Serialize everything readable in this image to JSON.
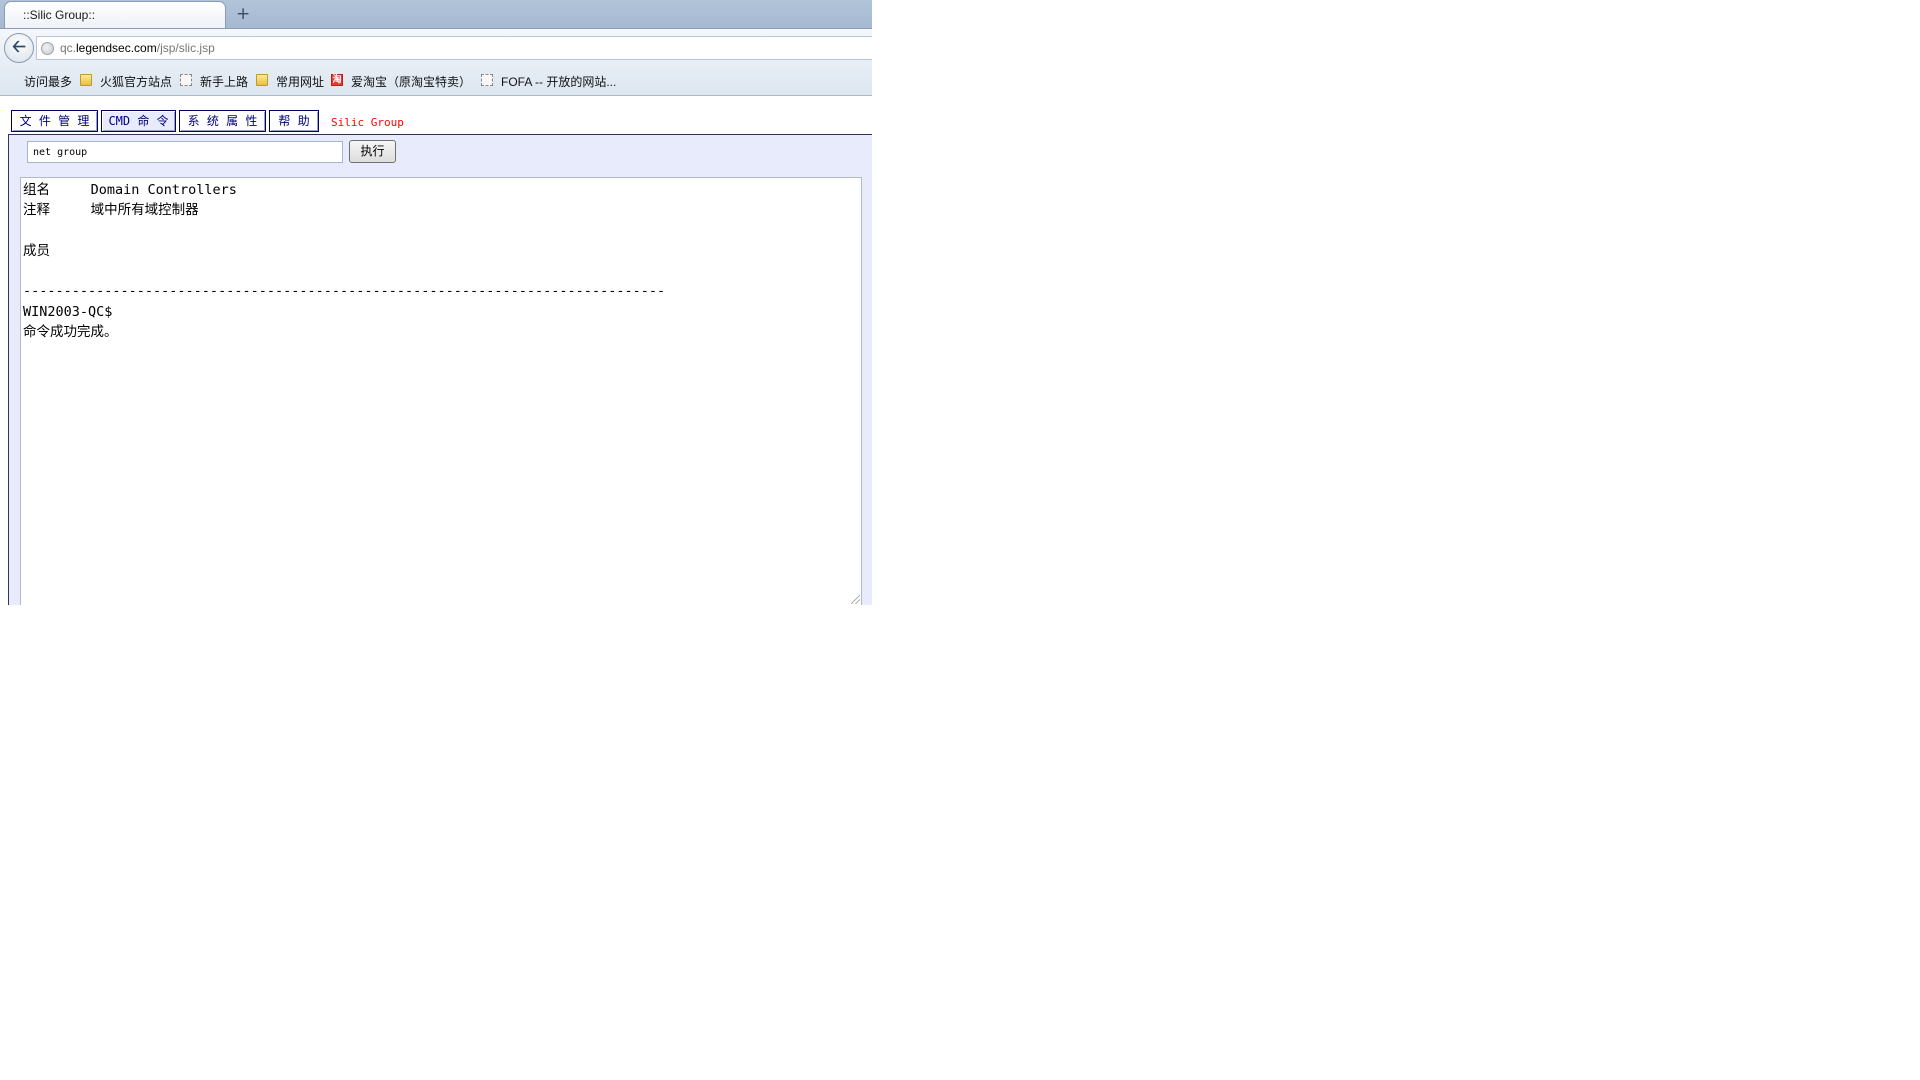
{
  "browser": {
    "tab": {
      "title": "::Silic Group::"
    },
    "new_tab_symbol": "+",
    "url": {
      "prefix": "qc.",
      "host": "legendsec.com",
      "path": "/jsp/slic.jsp"
    },
    "bookmarks": [
      {
        "label": "访问最多",
        "icon": "bookmark-page-icon"
      },
      {
        "label": "火狐官方站点",
        "icon": "folder-icon"
      },
      {
        "label": "新手上路",
        "icon": "dashed-page-icon"
      },
      {
        "label": "常用网址",
        "icon": "folder-icon"
      },
      {
        "label": "爱淘宝（原淘宝特卖）",
        "icon": "taobao-icon",
        "icon_glyph": "淘"
      },
      {
        "label": "FOFA -- 开放的网站...",
        "icon": "dashed-page-icon"
      }
    ]
  },
  "webshell": {
    "menu": [
      {
        "label": "文 件 管 理"
      },
      {
        "label": "CMD 命 令"
      },
      {
        "label": "系 统 属 性"
      },
      {
        "label": "帮 助"
      }
    ],
    "brand": "Silic Group",
    "command": {
      "value": "net group",
      "button_label": "执行"
    },
    "output": "组名     Domain Controllers\n注释     域中所有域控制器\n\n成员\n\n-------------------------------------------------------------------------------\nWIN2003-QC$\n命令成功完成。"
  },
  "colors": {
    "panel_bg": "#e8ebfb",
    "menu_text": "#000080",
    "brand_red": "#ff0000"
  }
}
